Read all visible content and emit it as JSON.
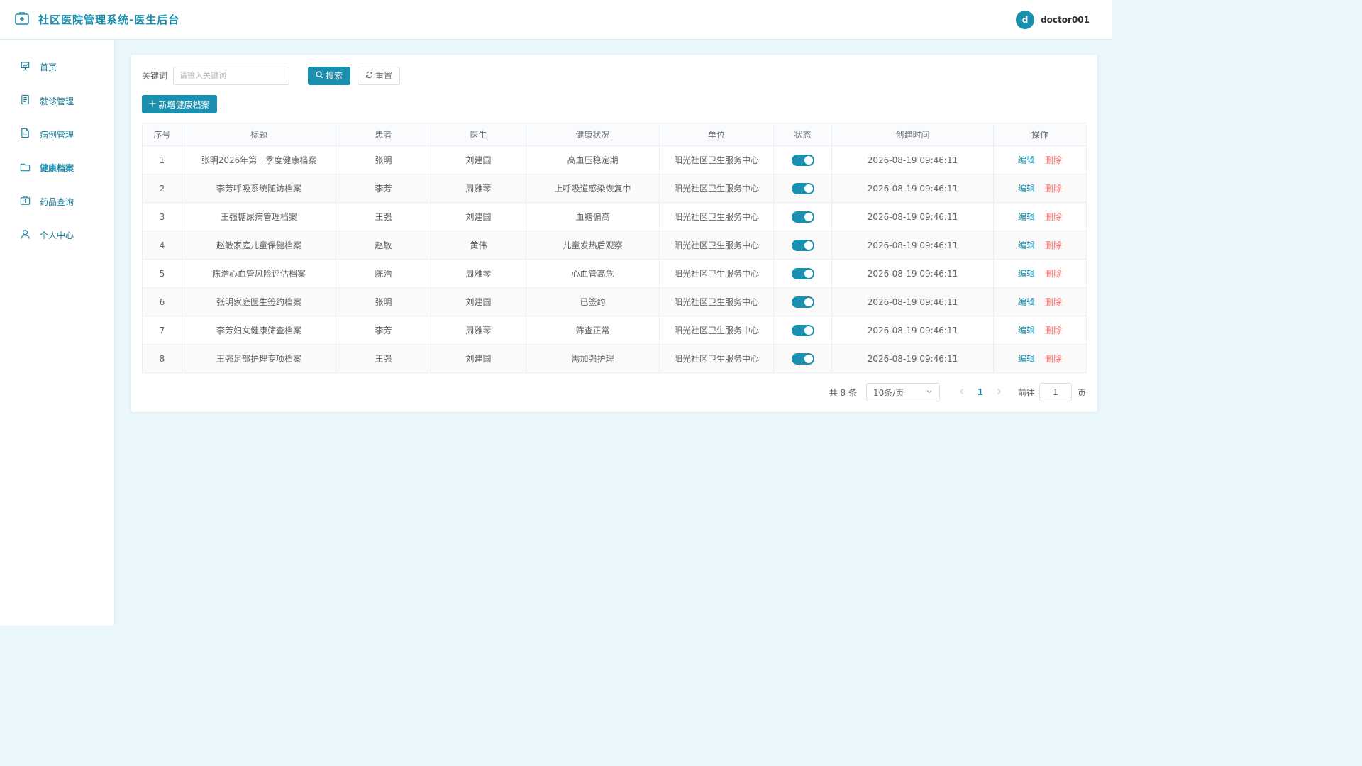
{
  "app": {
    "title": "社区医院管理系统-医生后台"
  },
  "user": {
    "avatar_letter": "d",
    "name": "doctor001"
  },
  "sidebar": {
    "items": [
      {
        "label": "首页",
        "icon": "presentation-icon",
        "active": false
      },
      {
        "label": "就诊管理",
        "icon": "document-icon",
        "active": false
      },
      {
        "label": "病例管理",
        "icon": "file-text-icon",
        "active": false
      },
      {
        "label": "健康档案",
        "icon": "folder-icon",
        "active": true
      },
      {
        "label": "药品查询",
        "icon": "medicine-box-icon",
        "active": false
      },
      {
        "label": "个人中心",
        "icon": "user-icon",
        "active": false
      }
    ]
  },
  "search": {
    "label": "关键词",
    "placeholder": "请输入关键词",
    "value": "",
    "search_button": "搜索",
    "reset_button": "重置"
  },
  "toolbar": {
    "add_button": "新增健康档案"
  },
  "table": {
    "columns": [
      "序号",
      "标题",
      "患者",
      "医生",
      "健康状况",
      "单位",
      "状态",
      "创建时间",
      "操作"
    ],
    "edit_label": "编辑",
    "delete_label": "删除",
    "rows": [
      {
        "no": "1",
        "title": "张明2026年第一季度健康档案",
        "patient": "张明",
        "doctor": "刘建国",
        "health": "高血压稳定期",
        "unit": "阳光社区卫生服务中心",
        "enabled": true,
        "created": "2026-08-19 09:46:11"
      },
      {
        "no": "2",
        "title": "李芳呼吸系统随访档案",
        "patient": "李芳",
        "doctor": "周雅琴",
        "health": "上呼吸道感染恢复中",
        "unit": "阳光社区卫生服务中心",
        "enabled": true,
        "created": "2026-08-19 09:46:11"
      },
      {
        "no": "3",
        "title": "王强糖尿病管理档案",
        "patient": "王强",
        "doctor": "刘建国",
        "health": "血糖偏高",
        "unit": "阳光社区卫生服务中心",
        "enabled": true,
        "created": "2026-08-19 09:46:11"
      },
      {
        "no": "4",
        "title": "赵敏家庭儿童保健档案",
        "patient": "赵敏",
        "doctor": "黄伟",
        "health": "儿童发热后观察",
        "unit": "阳光社区卫生服务中心",
        "enabled": true,
        "created": "2026-08-19 09:46:11"
      },
      {
        "no": "5",
        "title": "陈浩心血管风险评估档案",
        "patient": "陈浩",
        "doctor": "周雅琴",
        "health": "心血管高危",
        "unit": "阳光社区卫生服务中心",
        "enabled": true,
        "created": "2026-08-19 09:46:11"
      },
      {
        "no": "6",
        "title": "张明家庭医生签约档案",
        "patient": "张明",
        "doctor": "刘建国",
        "health": "已签约",
        "unit": "阳光社区卫生服务中心",
        "enabled": true,
        "created": "2026-08-19 09:46:11"
      },
      {
        "no": "7",
        "title": "李芳妇女健康筛查档案",
        "patient": "李芳",
        "doctor": "周雅琴",
        "health": "筛查正常",
        "unit": "阳光社区卫生服务中心",
        "enabled": true,
        "created": "2026-08-19 09:46:11"
      },
      {
        "no": "8",
        "title": "王强足部护理专项档案",
        "patient": "王强",
        "doctor": "刘建国",
        "health": "需加强护理",
        "unit": "阳光社区卫生服务中心",
        "enabled": true,
        "created": "2026-08-19 09:46:11"
      }
    ]
  },
  "pagination": {
    "total_text": "共 8 条",
    "page_size": "10条/页",
    "current_page": "1",
    "goto_label": "前往",
    "goto_value": "1",
    "page_suffix": "页"
  },
  "colors": {
    "primary": "#1b8fae",
    "danger": "#f56c6c",
    "background": "#eaf7fb"
  }
}
